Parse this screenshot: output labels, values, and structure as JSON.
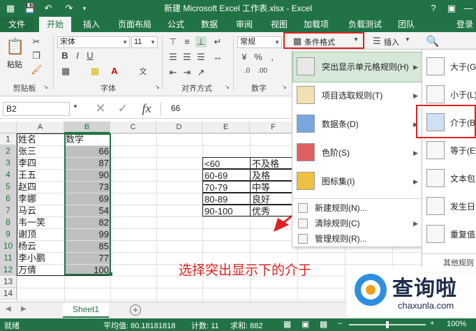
{
  "window": {
    "title": "新建 Microsoft Excel 工作表.xlsx - Excel"
  },
  "tabs": [
    "文件",
    "开始",
    "插入",
    "页面布局",
    "公式",
    "数据",
    "审阅",
    "视图",
    "加载项",
    "负载测试",
    "团队"
  ],
  "login": "登录",
  "ribbon": {
    "paste": "粘贴",
    "font_name": "宋体",
    "font_size": "11",
    "font_style_b": "B",
    "font_style_i": "I",
    "font_style_u": "U",
    "number_format": "常规",
    "cond_format": "条件格式",
    "insert": "插入",
    "groups": {
      "clipboard": "剪贴板",
      "font": "字体",
      "align": "对齐方式",
      "number": "数字"
    }
  },
  "formula_bar": {
    "name_box": "B2",
    "fx": "fx",
    "value": "66"
  },
  "grid": {
    "columns": [
      "A",
      "B",
      "C",
      "D",
      "E",
      "F"
    ],
    "rows": [
      "1",
      "2",
      "3",
      "4",
      "5",
      "6",
      "7",
      "8",
      "9",
      "10",
      "11",
      "12",
      "13",
      "14"
    ],
    "col_a": [
      "姓名",
      "张三",
      "李四",
      "王五",
      "赵四",
      "李娜",
      "马云",
      "韦一笑",
      "谢顶",
      "杨云",
      "李小鹏",
      "万倩"
    ],
    "col_b_header": "数学",
    "col_b": [
      "66",
      "87",
      "90",
      "73",
      "69",
      "54",
      "82",
      "99",
      "85",
      "77",
      "100"
    ],
    "col_e": [
      "<60",
      "60-69",
      "70-79",
      "80-89",
      "90-100"
    ],
    "col_f": [
      "不及格",
      "及格",
      "中等",
      "良好",
      "优秀"
    ]
  },
  "annotation": "选择突出显示下的介于",
  "menu": {
    "items": [
      {
        "label": "突出显示单元格规则(H)",
        "icon": "highlight-rules-icon"
      },
      {
        "label": "项目选取规则(T)",
        "icon": "top-bottom-rules-icon"
      },
      {
        "label": "数据条(D)",
        "icon": "data-bars-icon"
      },
      {
        "label": "色阶(S)",
        "icon": "color-scales-icon"
      },
      {
        "label": "图标集(I)",
        "icon": "icon-sets-icon"
      }
    ],
    "small_items": [
      "新建规则(N)...",
      "清除规则(C)",
      "管理规则(R)..."
    ]
  },
  "submenu": {
    "items": [
      "大于(G)",
      "小于(L)",
      "介于(B)",
      "等于(E)",
      "文本包",
      "发生日",
      "重复值"
    ],
    "other": "其他规则"
  },
  "sheet": {
    "tab": "Sheet1",
    "add": "+"
  },
  "status": {
    "ready": "就绪",
    "average": "平均值: 80.18181818",
    "count": "计数: 11",
    "sum": "求和: 882",
    "zoom": "100%"
  },
  "watermark": {
    "text_cn": "查询啦",
    "text_en": "chaxunla.com"
  },
  "colors": {
    "excel_green": "#217346",
    "red_box": "#e02020",
    "selection": "#bfbfbf"
  }
}
